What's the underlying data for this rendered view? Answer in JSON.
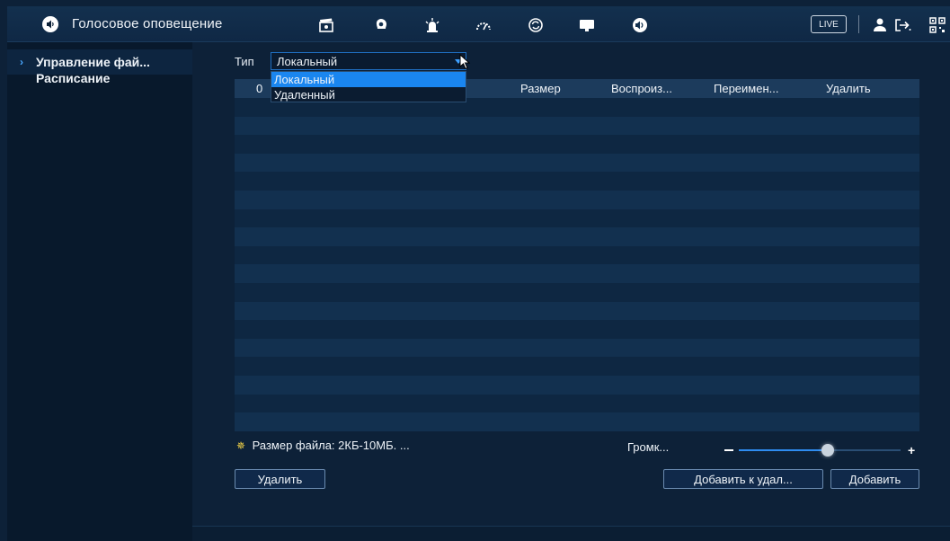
{
  "header": {
    "title": "Голосовое оповещение",
    "title_icon": "speaker-icon",
    "menu_icons": [
      "clapper-icon",
      "face-icon",
      "alarm-icon",
      "performance-icon",
      "sync-icon",
      "display-icon",
      "audio-icon"
    ],
    "live_label": "LIVE",
    "right_icons": [
      "user-icon",
      "logout-icon",
      "qr-icon"
    ]
  },
  "sidebar": {
    "items": [
      {
        "label": "Управление фай...",
        "active": true
      },
      {
        "label": "Расписание",
        "active": false
      }
    ]
  },
  "type_filter": {
    "label": "Тип",
    "value": "Локальный",
    "options": [
      "Локальный",
      "Удаленный"
    ]
  },
  "table": {
    "columns": [
      "0",
      "Размер",
      "Воспроиз...",
      "Переимен...",
      "Удалить"
    ],
    "rows": []
  },
  "hint": "Размер файла: 2КБ-10МБ. ...",
  "volume": {
    "label": "Громк...",
    "level": 0.55
  },
  "buttons": {
    "delete": "Удалить",
    "add_to_delete": "Добавить к удал...",
    "add": "Добавить"
  },
  "colors": {
    "accent": "#1a86f0",
    "background": "#0d2138",
    "sidebar": "#08192c"
  }
}
